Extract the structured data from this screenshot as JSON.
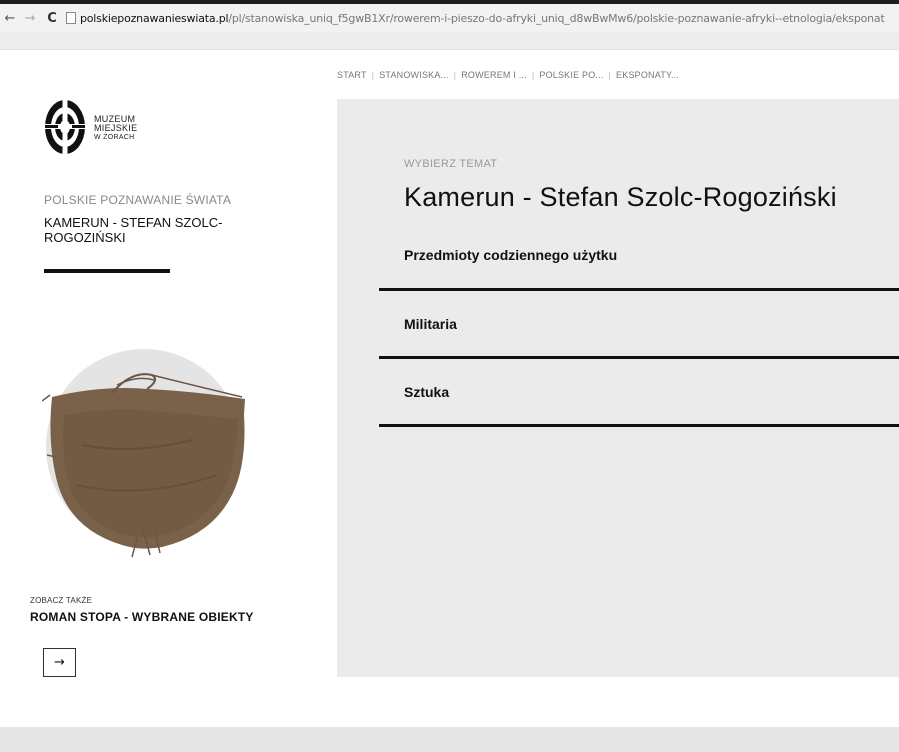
{
  "browser": {
    "url_domain": "polskiepoznawanieswiata.pl",
    "url_path": "/pl/stanowiska_uniq_f5gwB1Xr/rowerem-i-pieszo-do-afryki_uniq_d8wBwMw6/polskie-poznawanie-afryki--etnologia/eksponat"
  },
  "breadcrumb": {
    "items": [
      "START",
      "STANOWISKA...",
      "ROWEREM I ...",
      "POLSKIE PO...",
      "EKSPONATY..."
    ]
  },
  "logo": {
    "line1": "MUZEUM",
    "line2": "MIEJSKIE",
    "line3": "W ŻORACH"
  },
  "sidebar": {
    "section_label": "POLSKIE POZNAWANIE ŚWIATA",
    "section_title": "KAMERUN - STEFAN SZOLC-ROGOZIŃSKI",
    "see_also_label": "ZOBACZ TAKŻE",
    "see_also_link": "ROMAN STOPA - WYBRANE OBIEKTY",
    "arrow": "→"
  },
  "main": {
    "choose_label": "WYBIERZ TEMAT",
    "title": "Kamerun - Stefan Szolc-Rogoziński",
    "topics": [
      {
        "label": "Przedmioty codziennego użytku"
      },
      {
        "label": "Militaria"
      },
      {
        "label": "Sztuka"
      }
    ]
  },
  "colors": {
    "panel_bg": "#ebebeb",
    "accent": "#111111",
    "muted_text": "#888888"
  },
  "icons": {
    "back": "back-arrow-icon",
    "forward": "forward-arrow-icon",
    "reload": "reload-icon",
    "page": "page-icon",
    "logo": "museum-logo-icon",
    "arrow": "right-arrow-icon"
  }
}
